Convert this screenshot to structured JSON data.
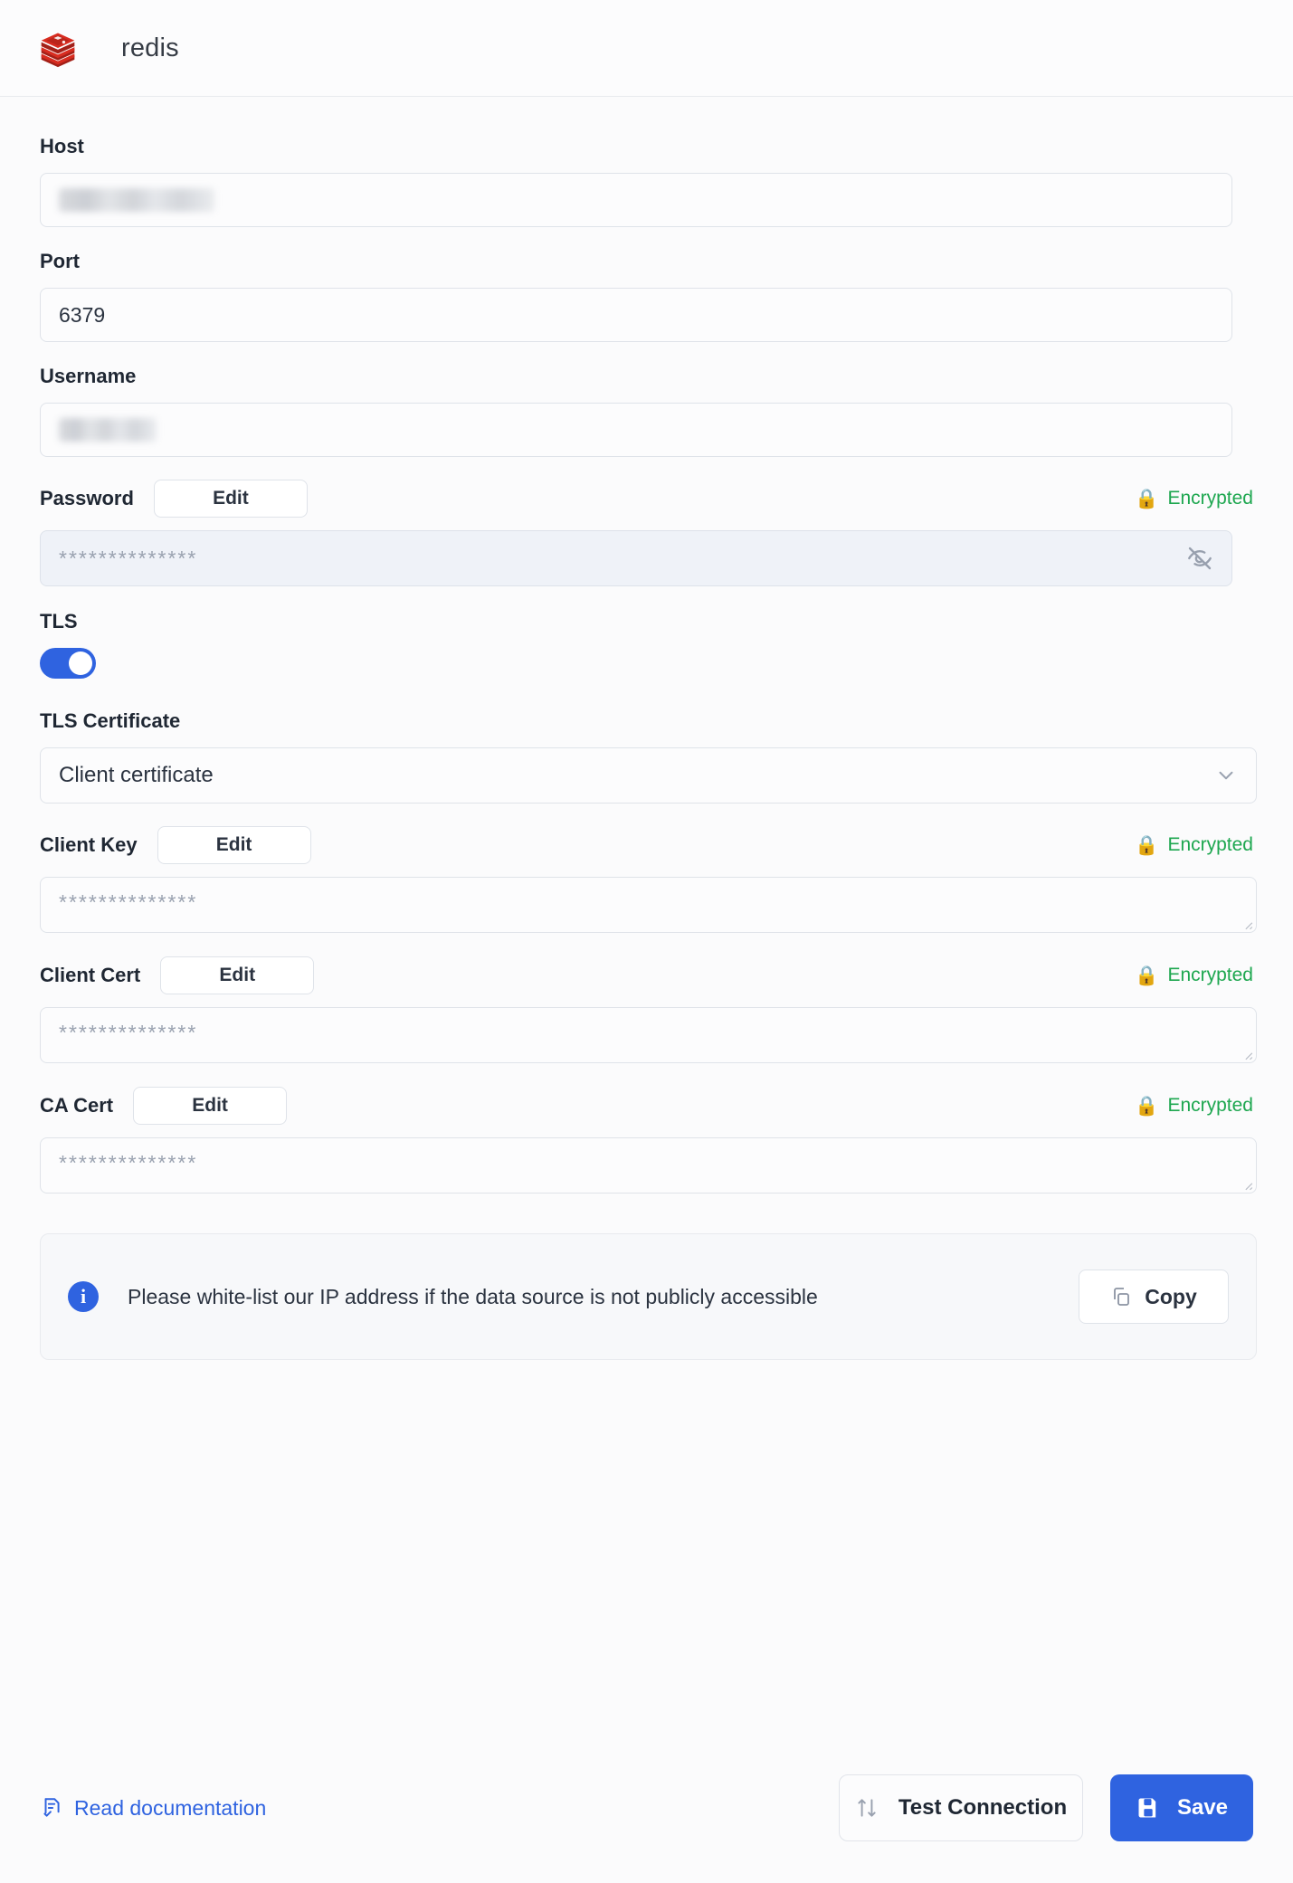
{
  "header": {
    "logo_icon": "redis-logo-icon",
    "title": "redis"
  },
  "form": {
    "host": {
      "label": "Host",
      "value": "",
      "redacted": true
    },
    "port": {
      "label": "Port",
      "value": "6379"
    },
    "username": {
      "label": "Username",
      "value": "",
      "redacted": true
    },
    "password": {
      "label": "Password",
      "edit_label": "Edit",
      "encrypted_label": "Encrypted",
      "lock_icon": "lock-icon",
      "value": "**************",
      "visibility_icon": "eye-off-icon"
    },
    "tls": {
      "label": "TLS",
      "enabled": true
    },
    "tls_certificate": {
      "label": "TLS Certificate",
      "selected": "Client certificate",
      "chevron_icon": "chevron-down-icon"
    },
    "client_key": {
      "label": "Client Key",
      "edit_label": "Edit",
      "encrypted_label": "Encrypted",
      "lock_icon": "lock-icon",
      "value": "**************"
    },
    "client_cert": {
      "label": "Client Cert",
      "edit_label": "Edit",
      "encrypted_label": "Encrypted",
      "lock_icon": "lock-icon",
      "value": "**************"
    },
    "ca_cert": {
      "label": "CA Cert",
      "edit_label": "Edit",
      "encrypted_label": "Encrypted",
      "lock_icon": "lock-icon",
      "value": "**************"
    }
  },
  "banner": {
    "info_icon": "info-icon",
    "glyph": "i",
    "message": "Please white-list our IP address if the data source is not publicly accessible",
    "copy_label": "Copy",
    "copy_icon": "copy-icon"
  },
  "footer": {
    "doc_link_label": "Read documentation",
    "doc_icon": "document-check-icon",
    "test_label": "Test Connection",
    "test_icon": "arrows-up-down-icon",
    "save_label": "Save",
    "save_icon": "floppy-disk-icon"
  },
  "colors": {
    "accent_blue": "#2f63e0",
    "encrypted_green": "#1ea750",
    "redis_red": "#d82c20",
    "page_bg": "#fbfbfc",
    "border": "#dfe3e9"
  }
}
